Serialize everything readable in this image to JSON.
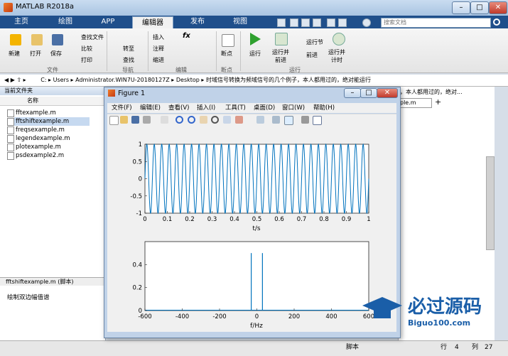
{
  "app": {
    "title": "MATLAB R2018a"
  },
  "window_controls": {
    "minimize": "–",
    "maximize": "□",
    "close": "✕"
  },
  "tabs": [
    {
      "label": "主页"
    },
    {
      "label": "绘图"
    },
    {
      "label": "APP"
    },
    {
      "label": "编辑器"
    },
    {
      "label": "发布"
    },
    {
      "label": "视图"
    }
  ],
  "search": {
    "placeholder": "搜索文档"
  },
  "ribbon": {
    "file": {
      "new": "新建",
      "open": "打开",
      "save": "保存",
      "find_files": "查找文件",
      "compare": "比较",
      "print": "打印",
      "group": "文件"
    },
    "nav": {
      "goto": "转至",
      "find": "查找",
      "group": "导航"
    },
    "edit": {
      "insert": "插入",
      "comment": "注释",
      "indent": "缩进",
      "fx": "fx",
      "group": "编辑"
    },
    "breakpoint": {
      "label": "断点",
      "group": "断点"
    },
    "run": {
      "run": "运行",
      "run_advance": "运行并\n前进",
      "run_section": "运行节",
      "advance": "前进",
      "run_time": "运行并\n计时",
      "group": "运行"
    }
  },
  "address": {
    "segments": [
      "C:",
      "Users",
      "Administrator.WIN7U-20180127Z",
      "Desktop",
      "时域信号转换为频域信号的几个例子，本人都用过的，绝对能运行"
    ]
  },
  "current_folder": {
    "title": "当前文件夹",
    "column": "名称",
    "files": [
      "fftexample.m",
      "fftshiftexample.m",
      "freqsexample.m",
      "legendexample.m",
      "plotexample.m",
      "psdexample2.m"
    ],
    "selected_index": 1,
    "detail_title": "fftshiftexample.m  (脚本)",
    "detail_text": "绘制双边幅值谱"
  },
  "editor_right": {
    "path_text": "，本人都用过的，绝对...",
    "tab_label": "ple.m",
    "add_tab": "+"
  },
  "status": {
    "mode": "脚本",
    "row_label": "行",
    "row": "4",
    "col_label": "列",
    "col": "27"
  },
  "figure": {
    "title": "Figure 1",
    "menu": [
      "文件(F)",
      "编辑(E)",
      "查看(V)",
      "插入(I)",
      "工具(T)",
      "桌面(D)",
      "窗口(W)",
      "帮助(H)"
    ]
  },
  "watermark": {
    "brand": "必过源码",
    "url": "Biguo100.com"
  },
  "chart_data": [
    {
      "type": "line",
      "xlabel": "t/s",
      "ylabel": "",
      "xlim": [
        0,
        1
      ],
      "ylim": [
        -1,
        1
      ],
      "xticks": [
        "0",
        "0.1",
        "0.2",
        "0.3",
        "0.4",
        "0.5",
        "0.6",
        "0.7",
        "0.8",
        "0.9",
        "1"
      ],
      "yticks": [
        "-1",
        "-0.5",
        "0",
        "0.5",
        "1"
      ],
      "signal": {
        "kind": "sine",
        "frequency": 30,
        "amplitude": 1
      },
      "color": "#0072bd"
    },
    {
      "type": "line",
      "xlabel": "f/Hz",
      "ylabel": "",
      "xlim": [
        -600,
        600
      ],
      "ylim": [
        0,
        0.6
      ],
      "xticks": [
        "-600",
        "-400",
        "-200",
        "0",
        "200",
        "400",
        "600"
      ],
      "yticks": [
        "0",
        "0.2",
        "0.4"
      ],
      "series": [
        {
          "x": [
            -30,
            30
          ],
          "values": [
            0.5,
            0.5
          ]
        }
      ],
      "color": "#0072bd"
    }
  ]
}
